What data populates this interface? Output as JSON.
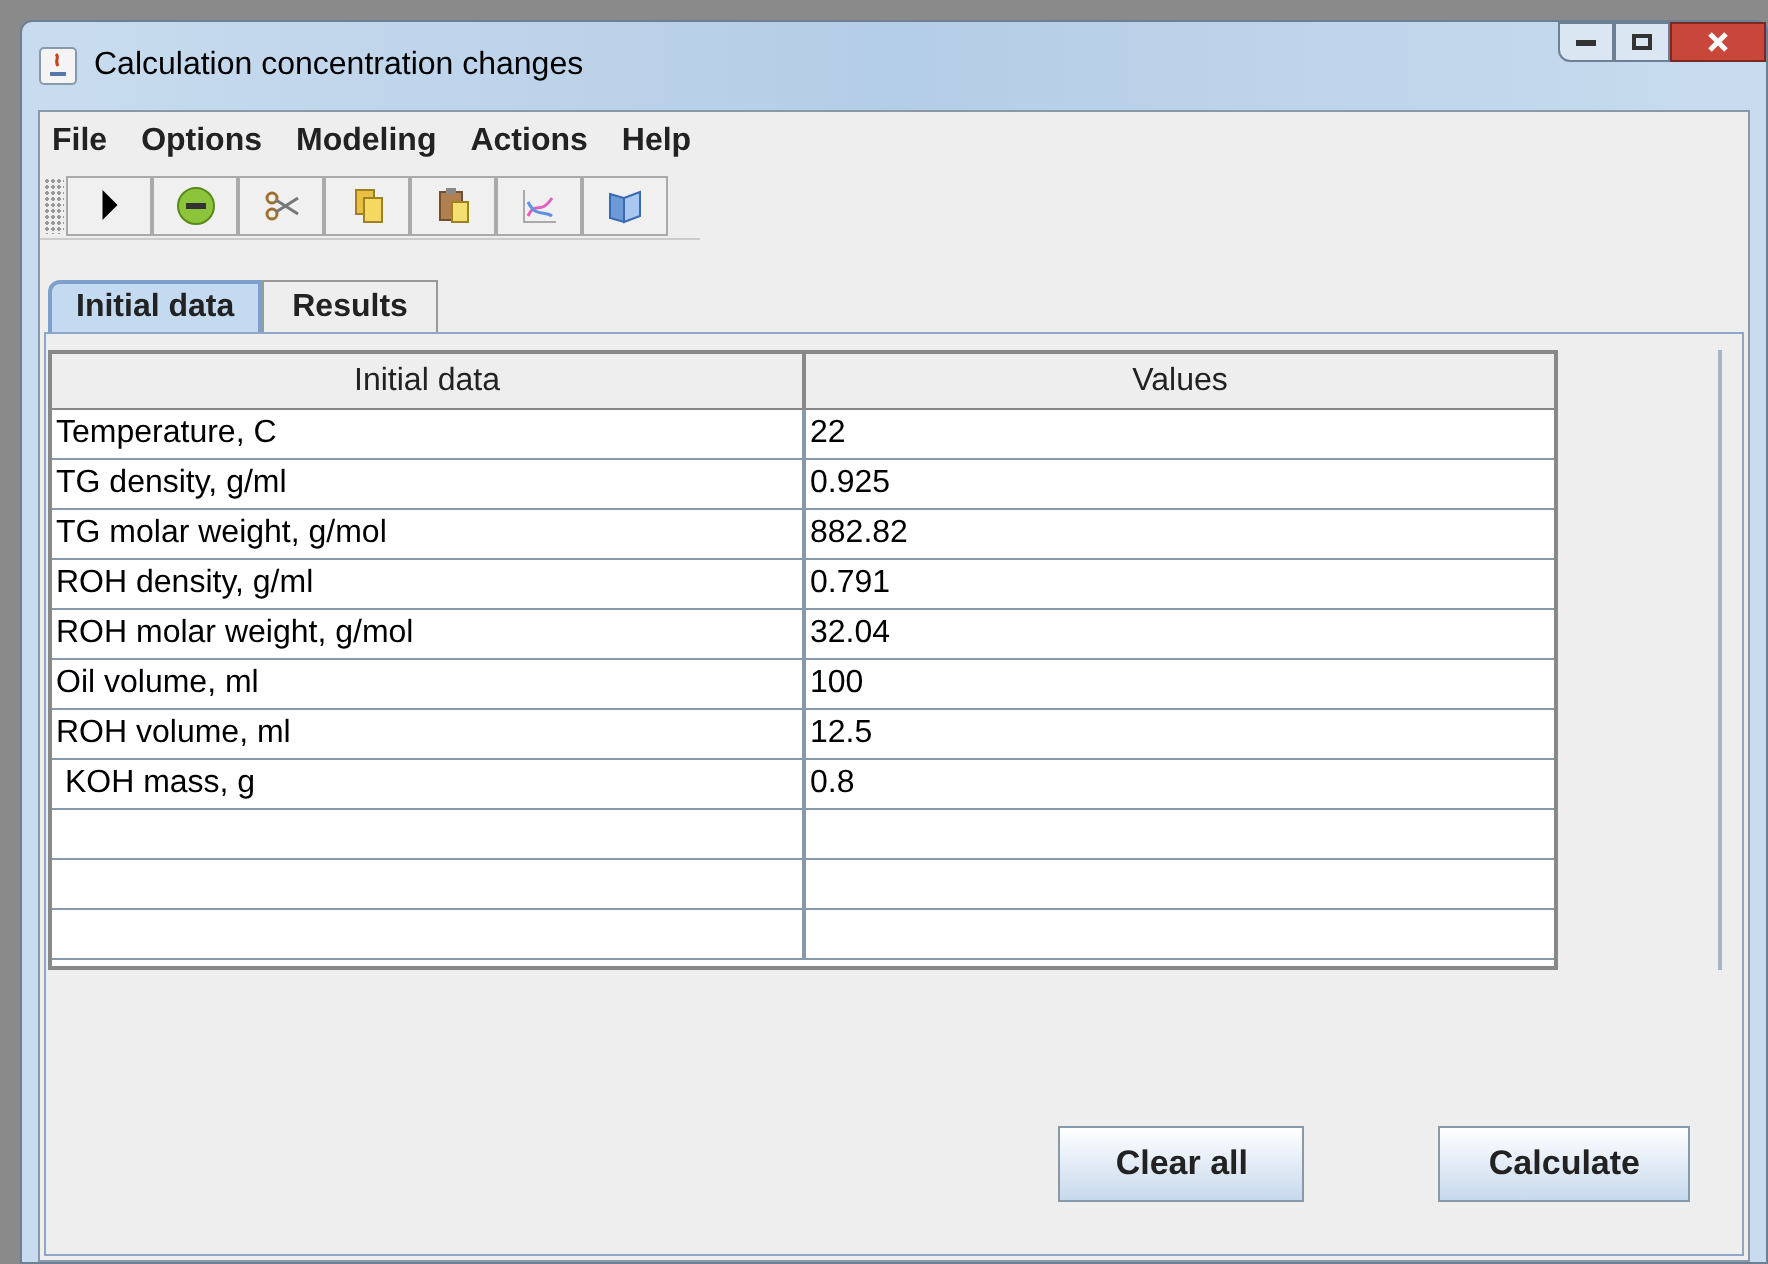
{
  "window": {
    "title": "Calculation concentration changes"
  },
  "menu": [
    "File",
    "Options",
    "Modeling",
    "Actions",
    "Help"
  ],
  "tabs": [
    {
      "label": "Initial data",
      "selected": true
    },
    {
      "label": "Results",
      "selected": false
    }
  ],
  "table": {
    "columns": [
      "Initial data",
      "Values"
    ],
    "rows": [
      [
        "Temperature, C",
        "22"
      ],
      [
        "TG density, g/ml",
        "0.925"
      ],
      [
        "TG molar weight, g/mol",
        "882.82"
      ],
      [
        "ROH density, g/ml",
        "0.791"
      ],
      [
        "ROH molar weight, g/mol",
        "32.04"
      ],
      [
        "Oil volume, ml",
        "100"
      ],
      [
        "ROH volume, ml",
        "12.5"
      ],
      [
        " KOH mass, g",
        "0.8"
      ]
    ]
  },
  "buttons": [
    "Clear all",
    "Calculate"
  ]
}
